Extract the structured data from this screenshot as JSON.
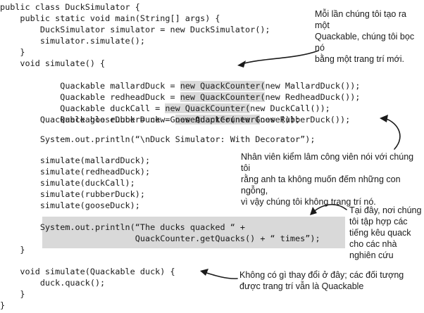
{
  "code": {
    "line01": "public class DuckSimulator {",
    "line02": "    public static void main(String[] args) {",
    "line03": "        DuckSimulator simulator = new DuckSimulator();",
    "line04": "        simulator.simulate();",
    "line05": "    }",
    "line06": "    void simulate() {",
    "line07": {
      "pre": "        Quackable mallardDuck = ",
      "hl": "new QuackCounter(",
      "post": "new MallardDuck());"
    },
    "line08": {
      "pre": "        Quackable redheadDuck = ",
      "hl": "new QuackCounter(",
      "post": "new RedheadDuck());"
    },
    "line09": {
      "pre": "        Quackable duckCall = ",
      "hl": "new QuackCounter(",
      "post": "new DuckCall());"
    },
    "line10": {
      "pre": "        Quackable rubberDuck = ",
      "hl": "new QuackCounter(",
      "post": "new RubberDuck());"
    },
    "line11": "        Quackable gooseDuck = new GooseAdapter(new Goose());",
    "line12": "        System.out.println(“\\nDuck Simulator: With Decorator”);",
    "line13": "        simulate(mallardDuck);",
    "line14": "        simulate(redheadDuck);",
    "line15": "        simulate(duckCall);",
    "line16": "        simulate(rubberDuck);",
    "line17": "        simulate(gooseDuck);",
    "line18": "        System.out.println(“The ducks quacked “ +",
    "line19": "                           QuackCounter.getQuacks() + “ times”);",
    "line20": "    }",
    "line21": "    void simulate(Quackable duck) {",
    "line22": "        duck.quack();",
    "line23": "    }",
    "line24": "}"
  },
  "annotations": {
    "note1": [
      "Mỗi lần chúng tôi tạo ra một",
      "Quackable, chúng tôi bọc nó",
      "bằng một trang trí mới."
    ],
    "note2": [
      "Nhân viên kiểm lâm công viên nói với chúng tôi",
      "rằng anh ta không muốn đếm những con ngỗng,",
      "vì vậy chúng tôi không trang trí nó."
    ],
    "note3": [
      "Tại đây, nơi chúng",
      "tôi tập hợp các",
      "tiếng kêu quack",
      "cho các nhà",
      "nghiên cứu"
    ],
    "note4": [
      "Không có gì thay đổi ở đây; các đối tượng",
      "được trang trí vẫn là Quackable"
    ]
  }
}
